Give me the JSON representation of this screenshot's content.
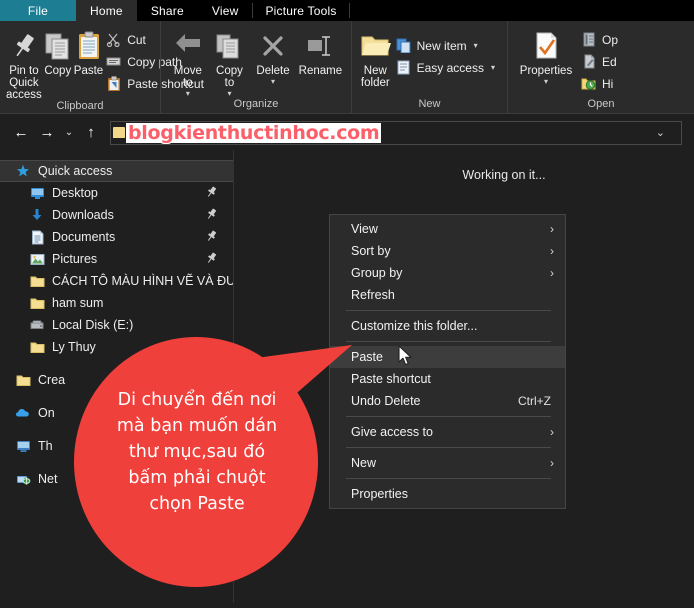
{
  "window": {
    "tabs": [
      {
        "label": "File",
        "state": "file"
      },
      {
        "label": "Home",
        "state": "active"
      },
      {
        "label": "Share",
        "state": "normal"
      },
      {
        "label": "View",
        "state": "normal"
      },
      {
        "label": "Picture Tools",
        "state": "contextual"
      }
    ]
  },
  "ribbon": {
    "groups": [
      {
        "label": "Clipboard",
        "big": [
          {
            "label": "Pin to Quick\naccess",
            "icon": "pin-icon"
          },
          {
            "label": "Copy",
            "icon": "copy-icon"
          },
          {
            "label": "Paste",
            "icon": "clipboard-icon"
          }
        ],
        "small": [
          {
            "label": "Cut",
            "icon": "scissors-icon"
          },
          {
            "label": "Copy path",
            "icon": "copy-path-icon"
          },
          {
            "label": "Paste shortcut",
            "icon": "paste-shortcut-icon"
          }
        ]
      },
      {
        "label": "Organize",
        "big": [
          {
            "label": "Move\nto",
            "icon": "move-to-icon",
            "caret": "▾"
          },
          {
            "label": "Copy\nto",
            "icon": "copy-to-icon",
            "caret": "▾"
          },
          {
            "label": "Delete",
            "icon": "delete-icon",
            "caret": "▾"
          },
          {
            "label": "Rename",
            "icon": "rename-icon"
          }
        ],
        "small": []
      },
      {
        "label": "New",
        "big": [
          {
            "label": "New\nfolder",
            "icon": "new-folder-icon"
          }
        ],
        "small": [
          {
            "label": "New item",
            "icon": "new-item-icon",
            "caret": "▾"
          },
          {
            "label": "Easy access",
            "icon": "easy-access-icon",
            "caret": "▾"
          }
        ]
      },
      {
        "label": "Open",
        "big": [
          {
            "label": "Properties",
            "icon": "properties-icon",
            "caret": "▾"
          }
        ],
        "small": [
          {
            "label": "Op",
            "icon": "open-icon"
          },
          {
            "label": "Ed",
            "icon": "edit-icon"
          },
          {
            "label": "Hi",
            "icon": "history-icon"
          }
        ]
      }
    ]
  },
  "nav": {
    "back": "←",
    "forward": "→",
    "recent": "⌄",
    "up": "↑",
    "address_value": "blogkienthuctinhoc.com",
    "address_chevron": "⌄"
  },
  "sidebar": {
    "items": [
      {
        "label": "Quick access",
        "icon": "star-icon",
        "selected": true,
        "pinned": false,
        "indent": false
      },
      {
        "label": "Desktop",
        "icon": "desktop-icon",
        "selected": false,
        "pinned": true,
        "indent": true
      },
      {
        "label": "Downloads",
        "icon": "downloads-icon",
        "selected": false,
        "pinned": true,
        "indent": true
      },
      {
        "label": "Documents",
        "icon": "documents-icon",
        "selected": false,
        "pinned": true,
        "indent": true
      },
      {
        "label": "Pictures",
        "icon": "pictures-icon",
        "selected": false,
        "pinned": true,
        "indent": true
      },
      {
        "label": "CÁCH TÔ MÀU HÌNH VẼ VÀ ĐƯỜN",
        "icon": "folder-icon",
        "selected": false,
        "pinned": false,
        "indent": true
      },
      {
        "label": "ham sum",
        "icon": "folder-icon",
        "selected": false,
        "pinned": false,
        "indent": true
      },
      {
        "label": "Local Disk (E:)",
        "icon": "drive-icon",
        "selected": false,
        "pinned": false,
        "indent": true
      },
      {
        "label": "Ly Thuy",
        "icon": "folder-icon",
        "selected": false,
        "pinned": false,
        "indent": true
      }
    ],
    "items2": [
      {
        "label": "Crea",
        "icon": "folder-icon"
      },
      {
        "label": "On",
        "icon": "onedrive-icon"
      },
      {
        "label": "Th",
        "icon": "thispc-icon"
      },
      {
        "label": "Net",
        "icon": "network-icon"
      }
    ]
  },
  "content": {
    "status_text": "Working on it..."
  },
  "context_menu": {
    "items": [
      {
        "label": "View",
        "submenu": "›",
        "accel": "",
        "highlight": false,
        "sep_after": false
      },
      {
        "label": "Sort by",
        "submenu": "›",
        "accel": "",
        "highlight": false,
        "sep_after": false
      },
      {
        "label": "Group by",
        "submenu": "›",
        "accel": "",
        "highlight": false,
        "sep_after": false
      },
      {
        "label": "Refresh",
        "submenu": "",
        "accel": "",
        "highlight": false,
        "sep_after": true
      },
      {
        "label": "Customize this folder...",
        "submenu": "",
        "accel": "",
        "highlight": false,
        "sep_after": true
      },
      {
        "label": "Paste",
        "submenu": "",
        "accel": "",
        "highlight": true,
        "sep_after": false
      },
      {
        "label": "Paste shortcut",
        "submenu": "",
        "accel": "",
        "highlight": false,
        "sep_after": false
      },
      {
        "label": "Undo Delete",
        "submenu": "",
        "accel": "Ctrl+Z",
        "highlight": false,
        "sep_after": true
      },
      {
        "label": "Give access to",
        "submenu": "›",
        "accel": "",
        "highlight": false,
        "sep_after": true
      },
      {
        "label": "New",
        "submenu": "›",
        "accel": "",
        "highlight": false,
        "sep_after": true
      },
      {
        "label": "Properties",
        "submenu": "",
        "accel": "",
        "highlight": false,
        "sep_after": false
      }
    ]
  },
  "callout": {
    "lines": [
      "Di chuyển đến nơi",
      "mà bạn muốn dán",
      "thư mục,sau đó",
      "bấm phải chuột",
      "chọn Paste"
    ],
    "color": "#f0403c"
  },
  "colors": {
    "background": "#1f1f1f",
    "ribbon": "#2b2b2b",
    "file_tab": "#1d7d93",
    "callout_red": "#f0403c",
    "watermark_text": "#fb5f6a",
    "highlight": "#3d3d3d"
  }
}
